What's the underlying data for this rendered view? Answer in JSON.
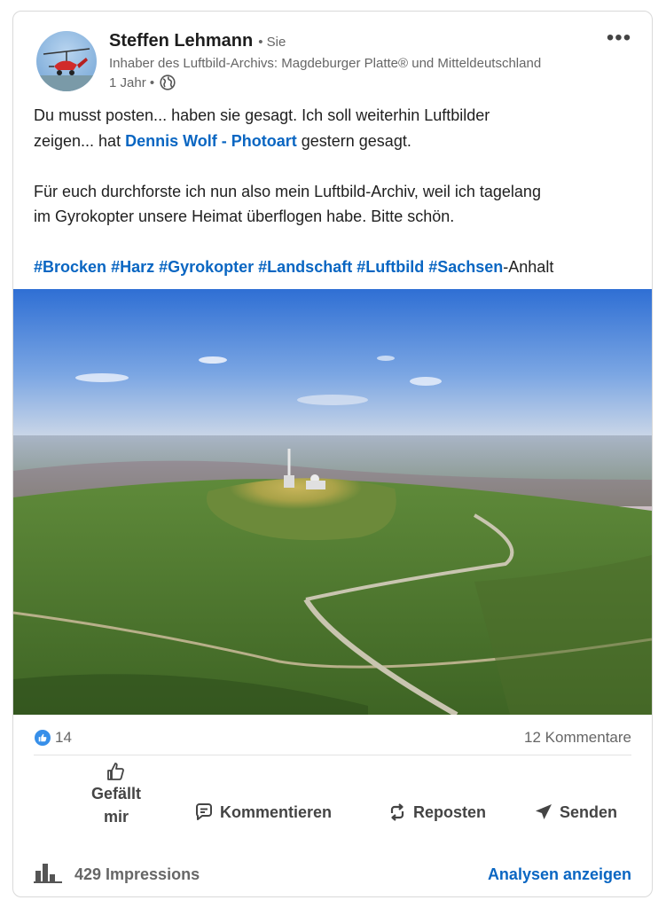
{
  "author": {
    "name": "Steffen Lehmann",
    "relation": "• Sie",
    "headline": "Inhaber des Luftbild-Archivs: Magdeburger Platte® und Mitteldeutschland",
    "time": "1 Jahr •",
    "visibility_icon": "globe-icon"
  },
  "post": {
    "line1": "Du musst posten... haben sie gesagt. Ich soll weiterhin Luftbilder",
    "line2_before": "zeigen... hat ",
    "mention": "Dennis Wolf - Photoart",
    "line2_after": " gestern gesagt.",
    "paragraph2_line1": "Für euch durchforste ich nun also mein Luftbild-Archiv, weil ich tagelang",
    "paragraph2_line2": "im Gyrokopter unsere Heimat überflogen habe. Bitte schön.",
    "hashtags": [
      "#Brocken",
      "#Harz",
      "#Gyrokopter",
      "#Landschaft",
      "#Luftbild",
      "#Sachsen"
    ],
    "hashtag_suffix": "-Anhalt"
  },
  "social": {
    "reaction_count": "14",
    "comments": "12 Kommentare"
  },
  "actions": {
    "like": "Gefällt mir",
    "like_line1": "Gefällt",
    "like_line2": "mir",
    "comment": "Kommentieren",
    "repost": "Reposten",
    "send": "Senden"
  },
  "footer": {
    "impressions": "429 Impressions",
    "analytics": "Analysen anzeigen"
  },
  "colors": {
    "link": "#0a66c2",
    "like_badge": "#378fe9",
    "muted_text": "#666666"
  }
}
